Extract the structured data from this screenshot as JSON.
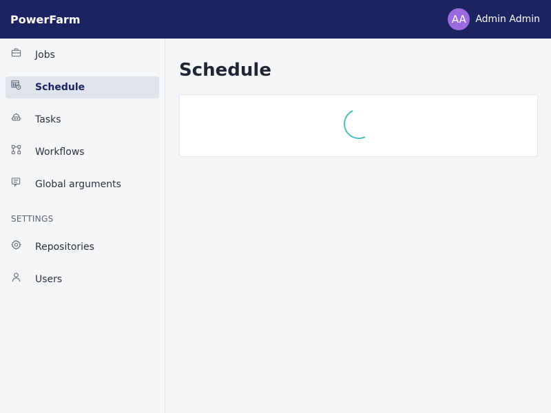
{
  "header": {
    "brand": "PowerFarm",
    "user": {
      "initials": "AA",
      "name": "Admin Admin"
    }
  },
  "sidebar": {
    "items": [
      {
        "label": "Jobs",
        "icon": "briefcase-icon"
      },
      {
        "label": "Schedule",
        "icon": "calendar-clock-icon",
        "active": true
      },
      {
        "label": "Tasks",
        "icon": "robot-icon"
      },
      {
        "label": "Workflows",
        "icon": "workflow-icon"
      },
      {
        "label": "Global arguments",
        "icon": "arguments-icon"
      }
    ],
    "settings_title": "SETTINGS",
    "settings_items": [
      {
        "label": "Repositories",
        "icon": "gear-icon"
      },
      {
        "label": "Users",
        "icon": "user-icon"
      }
    ]
  },
  "main": {
    "title": "Schedule",
    "loading": true
  },
  "colors": {
    "header_bg": "#1c2361",
    "avatar_bg": "#9b6adc",
    "active_item_bg": "#dfe3ec",
    "spinner": "#4bbdbd"
  }
}
